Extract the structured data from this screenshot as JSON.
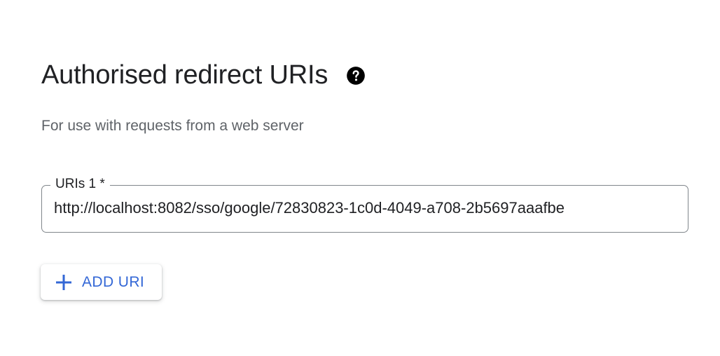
{
  "section": {
    "title": "Authorised redirect URIs",
    "help_icon": "help-circle-icon",
    "subtitle": "For use with requests from a web server"
  },
  "uri_field": {
    "label": "URIs 1 *",
    "value": "http://localhost:8082/sso/google/72830823-1c0d-4049-a708-2b5697aaafbe"
  },
  "add_button": {
    "icon": "plus-icon",
    "label": "ADD URI"
  },
  "colors": {
    "accent": "#3367d6",
    "title_text": "#202124",
    "secondary_text": "#5f6368",
    "field_border": "#80868b"
  }
}
